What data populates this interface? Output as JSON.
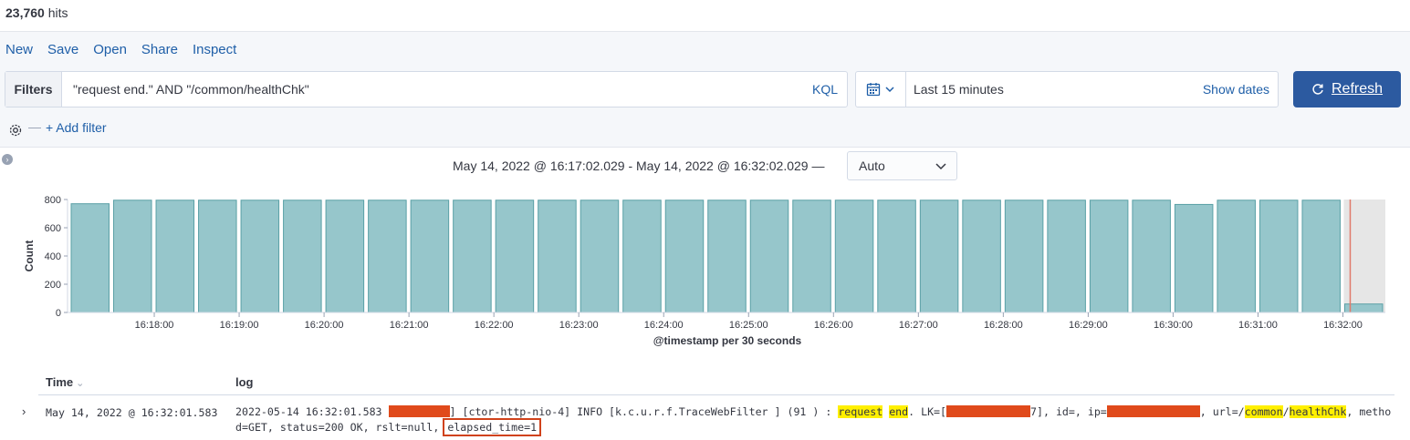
{
  "hits": {
    "count": "23,760",
    "label": "hits"
  },
  "menu": [
    "New",
    "Save",
    "Open",
    "Share",
    "Inspect"
  ],
  "filters": {
    "label": "Filters",
    "query": "\"request end.\" AND \"/common/healthChk\"",
    "language": "KQL"
  },
  "date_picker": {
    "range": "Last 15 minutes",
    "show_dates": "Show dates"
  },
  "refresh": {
    "label": "Refresh"
  },
  "add_filter": "+ Add filter",
  "histogram": {
    "range_text": "May 14, 2022 @ 16:17:02.029 - May 14, 2022 @ 16:32:02.029 —",
    "interval": "Auto"
  },
  "chart_data": {
    "type": "bar",
    "xlabel": "@timestamp per 30 seconds",
    "ylabel": "Count",
    "ylim": [
      0,
      800
    ],
    "yticks": [
      0,
      200,
      400,
      600,
      800
    ],
    "xtick_labels": [
      "16:18:00",
      "16:19:00",
      "16:20:00",
      "16:21:00",
      "16:22:00",
      "16:23:00",
      "16:24:00",
      "16:25:00",
      "16:26:00",
      "16:27:00",
      "16:28:00",
      "16:29:00",
      "16:30:00",
      "16:31:00",
      "16:32:00"
    ],
    "bar_times": [
      "16:17:00",
      "16:17:30",
      "16:18:00",
      "16:18:30",
      "16:19:00",
      "16:19:30",
      "16:20:00",
      "16:20:30",
      "16:21:00",
      "16:21:30",
      "16:22:00",
      "16:22:30",
      "16:23:00",
      "16:23:30",
      "16:24:00",
      "16:24:30",
      "16:25:00",
      "16:25:30",
      "16:26:00",
      "16:26:30",
      "16:27:00",
      "16:27:30",
      "16:28:00",
      "16:28:30",
      "16:29:00",
      "16:29:30",
      "16:30:00",
      "16:30:30",
      "16:31:00",
      "16:31:30",
      "16:32:00"
    ],
    "values": [
      770,
      795,
      795,
      795,
      795,
      795,
      795,
      795,
      795,
      795,
      795,
      795,
      795,
      795,
      795,
      795,
      795,
      795,
      795,
      795,
      795,
      795,
      795,
      795,
      795,
      795,
      765,
      795,
      795,
      795,
      60
    ],
    "bar_color": "#96c6cb",
    "grid": false
  },
  "table": {
    "columns": {
      "time": "Time",
      "log": "log"
    },
    "rows": [
      {
        "time": "May 14, 2022 @ 16:32:01.583",
        "log": {
          "p1": "2022-05-14 16:32:01.583 ",
          "p2": "] [ctor-http-nio-4]  INFO [k.c.u.r.f.TraceWebFilter    ] (91  ) : ",
          "hl_request": "request",
          "hl_end": "end",
          "p3": ". LK=[",
          "p4": "7], id=, ip=",
          "p5": ", url=/",
          "hl_common": "common",
          "slash": "/",
          "hl_health": "healthChk",
          "p6": ", method=GET, status=200 OK, rslt=null, ",
          "elapsed": "elapsed_time=1"
        }
      }
    ]
  },
  "colors": {
    "link": "#1f5fa8",
    "primary_button": "#2c5aa0",
    "bar": "#96c6cb",
    "highlight": "#fff000",
    "redaction": "#e04a1b"
  }
}
